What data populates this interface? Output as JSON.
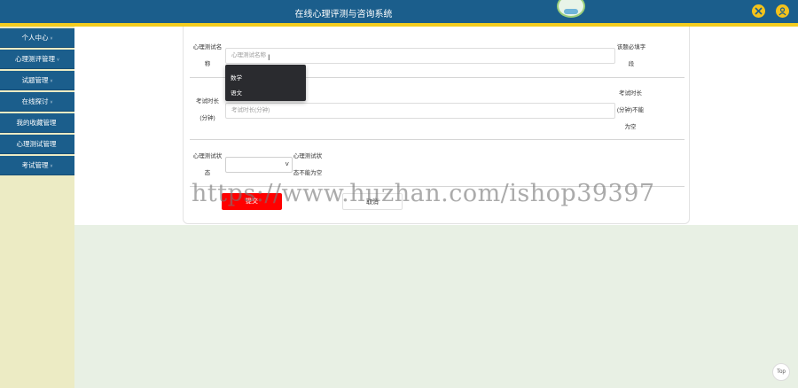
{
  "header": {
    "title": "在线心理评测与咨询系统"
  },
  "sidebar": {
    "items": [
      {
        "label": "个人中心",
        "arrow": "˅"
      },
      {
        "label": "心理测评管理",
        "arrow": "˅"
      },
      {
        "label": "试题管理",
        "arrow": "˅"
      },
      {
        "label": "在线探讨",
        "arrow": "˅"
      },
      {
        "label": "我的收藏管理",
        "arrow": ""
      },
      {
        "label": "心理测试管理",
        "arrow": ""
      },
      {
        "label": "考试管理",
        "arrow": "˅"
      }
    ]
  },
  "form": {
    "name_label_line1": "心理测试名",
    "name_label_line2": "称",
    "name_placeholder": "心理测试名称",
    "name_hint_line1": "该题必填字",
    "name_hint_line2": "段",
    "duration_label_line1": "考试时长",
    "duration_label_line2": "(分钟)",
    "duration_placeholder": "考试时长(分钟)",
    "duration_hint_line1": "考试时长",
    "duration_hint_line2": "(分钟)不能",
    "duration_hint_line3": "为空",
    "status_label_line1": "心理测试状",
    "status_label_line2": "态",
    "status_hint_line1": "心理测试状",
    "status_hint_line2": "态不能为空",
    "submit_label": "提交",
    "cancel_label": "取消"
  },
  "dropdown": {
    "options": [
      "数学",
      "语文"
    ]
  },
  "watermark": "https://www.huzhan.com/ishop39397",
  "top_button": "Top",
  "colors": {
    "header": "#1b5e8c",
    "accent_strip": "#f3cc1e",
    "submit": "#ff0000",
    "sidebar_bg": "#ecebc4",
    "content_bg": "#e8f0e4"
  }
}
